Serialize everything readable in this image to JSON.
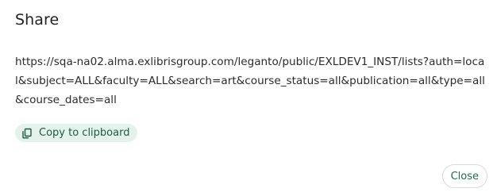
{
  "dialog": {
    "title": "Share",
    "url": "https://sqa-na02.alma.exlibrisgroup.com/leganto/public/EXLDEV1_INST/lists?auth=local&subject=ALL&faculty=ALL&search=art&course_status=all&publication=all&type=all&course_dates=all",
    "copy_button_label": "Copy to clipboard",
    "copy_icon": "copy-icon",
    "close_button_label": "Close"
  },
  "colors": {
    "accent": "#1c6b52",
    "chip_background": "#e4f2ec"
  }
}
